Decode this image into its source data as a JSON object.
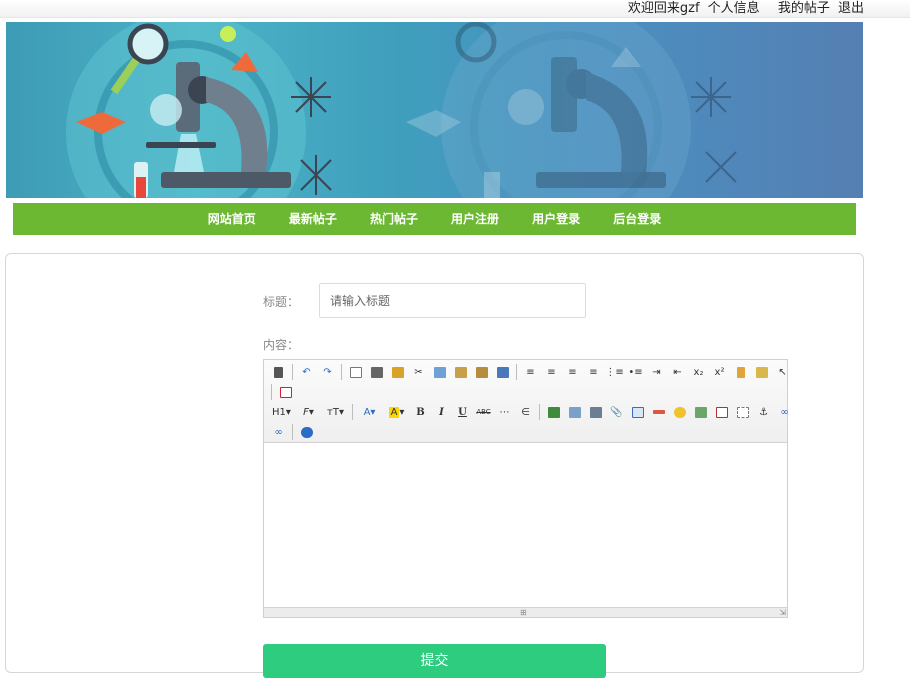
{
  "topbar": {
    "welcome": "欢迎回来gzf",
    "profile": "个人信息",
    "my_posts": "我的帖子",
    "logout": "退出"
  },
  "nav": {
    "items": [
      "网站首页",
      "最新帖子",
      "热门帖子",
      "用户注册",
      "用户登录",
      "后台登录"
    ]
  },
  "form": {
    "title_label": "标题：",
    "title_placeholder": "请输入标题",
    "content_label": "内容：",
    "submit_label": "提交"
  },
  "editor": {
    "heading_label": "H1",
    "font_family_label": "F",
    "font_size_label": "тT",
    "font_color_label": "A",
    "bg_color_label": "A",
    "bold": "B",
    "italic": "I",
    "underline": "U",
    "strike": "ABC"
  },
  "colors": {
    "nav_bg": "#6db833",
    "submit_bg": "#2dcc7e",
    "banner_blue": "#4a9cc0"
  }
}
